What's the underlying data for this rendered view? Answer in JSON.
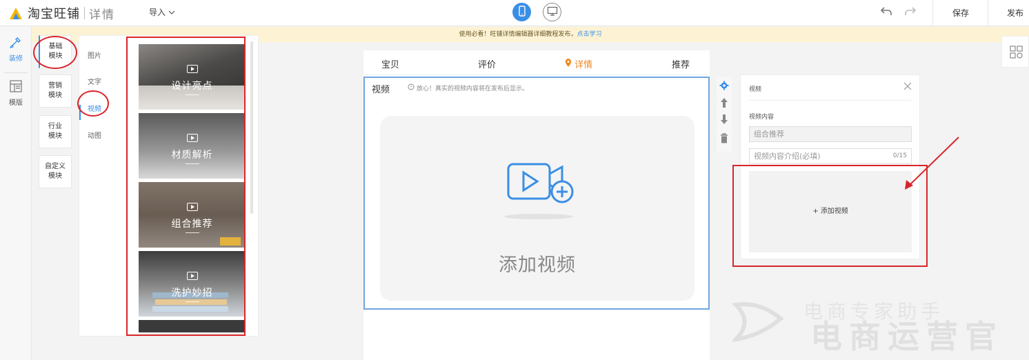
{
  "topbar": {
    "brand": "淘宝旺铺",
    "sub": "详情",
    "import_label": "导入",
    "save_label": "保存",
    "publish_label": "发布"
  },
  "rail": [
    {
      "label": "装修",
      "icon": "brush-icon"
    },
    {
      "label": "模版",
      "icon": "template-icon"
    }
  ],
  "notice": {
    "text": "使用必看！旺铺详情编辑器详细教程发布，",
    "link": "点击学习"
  },
  "categories": [
    {
      "label": "基础\n模块",
      "line1": "基础",
      "line2": "模块"
    },
    {
      "line1": "营销",
      "line2": "模块"
    },
    {
      "line1": "行业",
      "line2": "模块"
    },
    {
      "line1": "自定义",
      "line2": "模块"
    }
  ],
  "subtypes": [
    "图片",
    "文字",
    "视频",
    "动图"
  ],
  "thumbnails": [
    "设计亮点",
    "材质解析",
    "组合推荐",
    "洗护妙招"
  ],
  "preview": {
    "tabs": [
      "宝贝",
      "评价",
      "详情",
      "推荐"
    ],
    "module_title": "视频",
    "tip": "放心！真实的视频内容将在发布后显示。",
    "add_text": "添加视频"
  },
  "prop_panel": {
    "title": "视频",
    "content_label": "视频内容",
    "content_value": "组合推荐",
    "intro_placeholder": "视频内容介绍(必填)",
    "intro_count": "0/15",
    "add_button": "+ 添加视频"
  },
  "watermark": {
    "line1": "电商运营官",
    "line2": "电商专家助手"
  },
  "colors": {
    "accent": "#3a8ee6",
    "active_tab": "#f08a24",
    "annotation": "#d9252b",
    "notice_bg": "#fdf3d4"
  }
}
